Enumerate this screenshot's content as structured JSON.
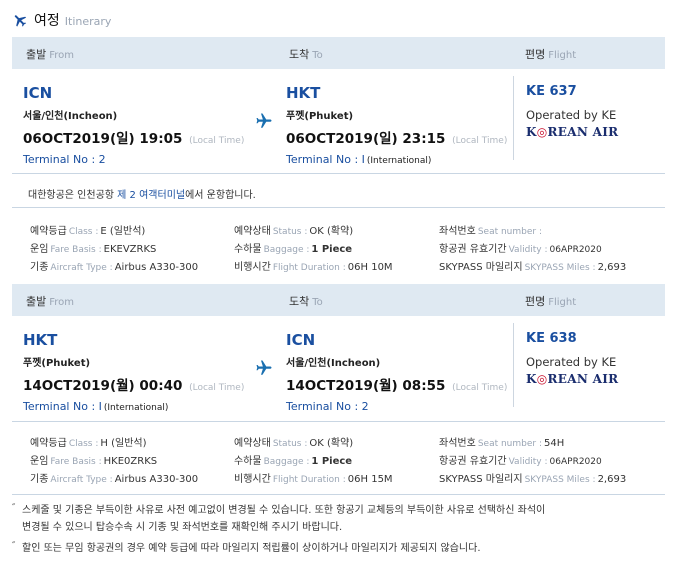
{
  "section": {
    "title_ko": "여정",
    "title_en": "Itinerary",
    "icon": "airplane-icon"
  },
  "columns": {
    "from_ko": "출발",
    "from_en": "From",
    "to_ko": "도착",
    "to_en": "To",
    "flight_ko": "편명",
    "flight_en": "Flight"
  },
  "segments": [
    {
      "dep": {
        "code": "ICN",
        "city": "서울/인천(Incheon)",
        "datetime": "06OCT2019(일) 19:05",
        "local": "(Local Time)",
        "terminal": "Terminal No : 2",
        "intl": ""
      },
      "arr": {
        "code": "HKT",
        "city": "푸껫(Phuket)",
        "datetime": "06OCT2019(일) 23:15",
        "local": "(Local Time)",
        "terminal": "Terminal No : I",
        "intl": "(International)"
      },
      "flight": {
        "no": "KE 637",
        "operated": "Operated by KE",
        "airline_logo": "KOREAN AIR"
      },
      "notice": {
        "pre": "대한항공은 인천공항 ",
        "highlight": "제 2 여객터미널",
        "post": "에서 운항합니다."
      },
      "info": {
        "class_ko": "예약등급",
        "class_en": "Class :",
        "class_val": "E (일반석)",
        "status_ko": "예약상태",
        "status_en": "Status :",
        "status_val": "OK (확약)",
        "seat_ko": "좌석번호",
        "seat_en": "Seat number :",
        "seat_val": "",
        "fare_ko": "운임",
        "fare_en": "Fare Basis :",
        "fare_val": "EKEVZRKS",
        "baggage_ko": "수하물",
        "baggage_en": "Baggage :",
        "baggage_val": "1 Piece",
        "validity_ko": "항공권 유효기간",
        "validity_en": "Validity :",
        "validity_val": "06APR2020",
        "aircraft_ko": "기종",
        "aircraft_en": "Aircraft Type :",
        "aircraft_val": "Airbus A330-300",
        "duration_ko": "비행시간",
        "duration_en": "Flight Duration :",
        "duration_val": "06H 10M",
        "miles_ko": "SKYPASS 마일리지",
        "miles_en": "SKYPASS Miles :",
        "miles_val": "2,693"
      }
    },
    {
      "dep": {
        "code": "HKT",
        "city": "푸껫(Phuket)",
        "datetime": "14OCT2019(월) 00:40",
        "local": "(Local Time)",
        "terminal": "Terminal No : I",
        "intl": "(International)"
      },
      "arr": {
        "code": "ICN",
        "city": "서울/인천(Incheon)",
        "datetime": "14OCT2019(월) 08:55",
        "local": "(Local Time)",
        "terminal": "Terminal No : 2",
        "intl": ""
      },
      "flight": {
        "no": "KE 638",
        "operated": "Operated by KE",
        "airline_logo": "KOREAN AIR"
      },
      "info": {
        "class_ko": "예약등급",
        "class_en": "Class :",
        "class_val": "H (일반석)",
        "status_ko": "예약상태",
        "status_en": "Status :",
        "status_val": "OK (확약)",
        "seat_ko": "좌석번호",
        "seat_en": "Seat number :",
        "seat_val": "54H",
        "fare_ko": "운임",
        "fare_en": "Fare Basis :",
        "fare_val": "HKE0ZRKS",
        "baggage_ko": "수하물",
        "baggage_en": "Baggage :",
        "baggage_val": "1 Piece",
        "validity_ko": "항공권 유효기간",
        "validity_en": "Validity :",
        "validity_val": "06APR2020",
        "aircraft_ko": "기종",
        "aircraft_en": "Aircraft Type :",
        "aircraft_val": "Airbus A330-300",
        "duration_ko": "비행시간",
        "duration_en": "Flight Duration :",
        "duration_val": "06H 15M",
        "miles_ko": "SKYPASS 마일리지",
        "miles_en": "SKYPASS Miles :",
        "miles_val": "2,693"
      }
    }
  ],
  "footnotes": [
    "스케줄 및 기종은 부득이한 사유로 사전 예고없이 변경될 수 있습니다. 또한 항공기 교체등의 부득이한 사유로 선택하신 좌석이",
    "변경될 수 있으니 탑승수속 시 기종 및 좌석번호를 재확인해 주시기 바랍니다.",
    "할인 또는 무임 항공권의 경우 예약 등급에 따라 마일리지 적립률이 상이하거나 마일리지가 제공되지 않습니다."
  ],
  "colors": {
    "accent": "#1a4fa0",
    "header_bg": "#dfe9f2",
    "muted": "#9aa5b4"
  }
}
